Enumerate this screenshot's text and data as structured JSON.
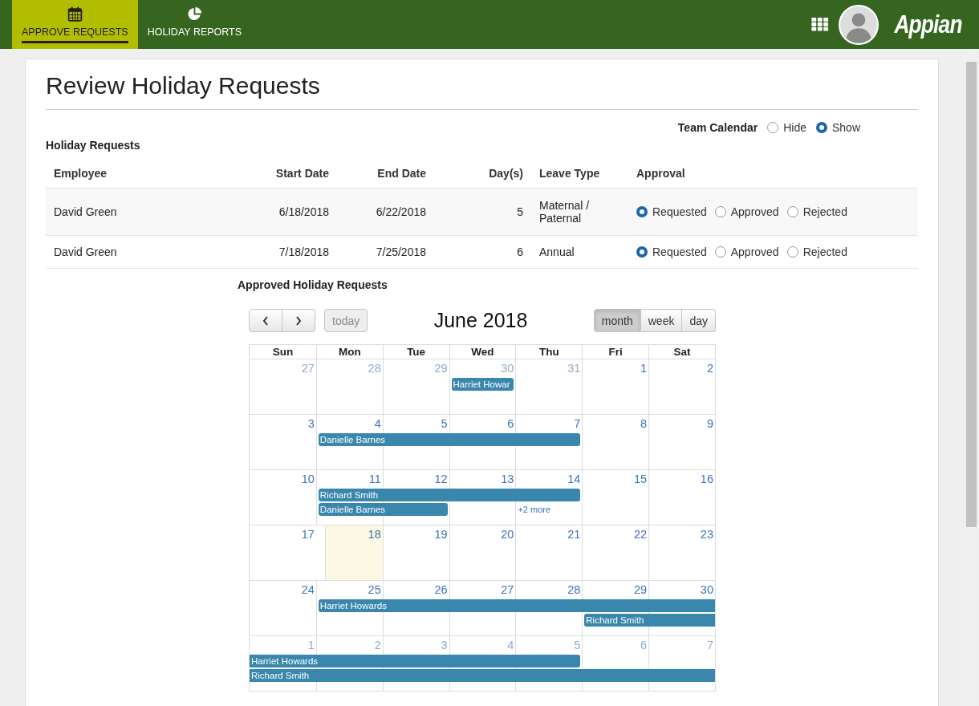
{
  "nav": {
    "tabs": [
      {
        "label": "APPROVE REQUESTS",
        "selected": true
      },
      {
        "label": "HOLIDAY REPORTS",
        "selected": false
      }
    ],
    "logo": "Appian"
  },
  "page": {
    "title": "Review Holiday Requests",
    "team_calendar": {
      "label": "Team Calendar",
      "options": [
        {
          "label": "Hide",
          "selected": false
        },
        {
          "label": "Show",
          "selected": true
        }
      ]
    },
    "requests": {
      "title": "Holiday Requests",
      "columns": [
        "Employee",
        "Start Date",
        "End Date",
        "Day(s)",
        "Leave Type",
        "Approval"
      ],
      "rows": [
        {
          "employee": "David Green",
          "start": "6/18/2018",
          "end": "6/22/2018",
          "days": "5",
          "leave_type": "Maternal / Paternal",
          "approval": [
            {
              "label": "Requested",
              "selected": true
            },
            {
              "label": "Approved",
              "selected": false
            },
            {
              "label": "Rejected",
              "selected": false
            }
          ]
        },
        {
          "employee": "David Green",
          "start": "7/18/2018",
          "end": "7/25/2018",
          "days": "6",
          "leave_type": "Annual",
          "approval": [
            {
              "label": "Requested",
              "selected": true
            },
            {
              "label": "Approved",
              "selected": false
            },
            {
              "label": "Rejected",
              "selected": false
            }
          ]
        }
      ]
    },
    "calendar": {
      "title": "Approved Holiday Requests",
      "today_button": "today",
      "month": "June 2018",
      "views": [
        {
          "label": "month",
          "selected": true
        },
        {
          "label": "week",
          "selected": false
        },
        {
          "label": "day",
          "selected": false
        }
      ],
      "weekdays": [
        "Sun",
        "Mon",
        "Tue",
        "Wed",
        "Thu",
        "Fri",
        "Sat"
      ],
      "weeks": [
        {
          "days": [
            {
              "n": "27",
              "other_month": true,
              "today": false
            },
            {
              "n": "28",
              "other_month": true,
              "today": false
            },
            {
              "n": "29",
              "other_month": true,
              "today": false
            },
            {
              "n": "30",
              "other_month": true,
              "today": false
            },
            {
              "n": "31",
              "other_month": true,
              "today": false
            },
            {
              "n": "1",
              "other_month": false,
              "today": false
            },
            {
              "n": "2",
              "other_month": false,
              "today": false
            }
          ],
          "events": [
            {
              "title": "Harriet Howar",
              "continues_before": false,
              "continues_after": false
            }
          ]
        },
        {
          "days": [
            {
              "n": "3",
              "other_month": false,
              "today": false
            },
            {
              "n": "4",
              "other_month": false,
              "today": false
            },
            {
              "n": "5",
              "other_month": false,
              "today": false
            },
            {
              "n": "6",
              "other_month": false,
              "today": false
            },
            {
              "n": "7",
              "other_month": false,
              "today": false
            },
            {
              "n": "8",
              "other_month": false,
              "today": false
            },
            {
              "n": "9",
              "other_month": false,
              "today": false
            }
          ],
          "events": [
            {
              "title": "Danielle Barnes",
              "continues_before": false,
              "continues_after": false
            }
          ]
        },
        {
          "days": [
            {
              "n": "10",
              "other_month": false,
              "today": false
            },
            {
              "n": "11",
              "other_month": false,
              "today": false
            },
            {
              "n": "12",
              "other_month": false,
              "today": false
            },
            {
              "n": "13",
              "other_month": false,
              "today": false
            },
            {
              "n": "14",
              "other_month": false,
              "today": false
            },
            {
              "n": "15",
              "other_month": false,
              "today": false
            },
            {
              "n": "16",
              "other_month": false,
              "today": false
            }
          ],
          "events": [
            {
              "title": "Richard Smith",
              "continues_before": false,
              "continues_after": false
            },
            {
              "title": "Danielle Barnes",
              "continues_before": false,
              "continues_after": false
            }
          ],
          "more": "+2 more"
        },
        {
          "days": [
            {
              "n": "17",
              "other_month": false,
              "today": false
            },
            {
              "n": "18",
              "other_month": false,
              "today": true
            },
            {
              "n": "19",
              "other_month": false,
              "today": false
            },
            {
              "n": "20",
              "other_month": false,
              "today": false
            },
            {
              "n": "21",
              "other_month": false,
              "today": false
            },
            {
              "n": "22",
              "other_month": false,
              "today": false
            },
            {
              "n": "23",
              "other_month": false,
              "today": false
            }
          ]
        },
        {
          "days": [
            {
              "n": "24",
              "other_month": false,
              "today": false
            },
            {
              "n": "25",
              "other_month": false,
              "today": false
            },
            {
              "n": "26",
              "other_month": false,
              "today": false
            },
            {
              "n": "27",
              "other_month": false,
              "today": false
            },
            {
              "n": "28",
              "other_month": false,
              "today": false
            },
            {
              "n": "29",
              "other_month": false,
              "today": false
            },
            {
              "n": "30",
              "other_month": false,
              "today": false
            }
          ],
          "events": [
            {
              "title": "Harriet Howards",
              "continues_before": false,
              "continues_after": true
            },
            {
              "title": "Richard Smith",
              "continues_before": false,
              "continues_after": true
            }
          ]
        },
        {
          "days": [
            {
              "n": "1",
              "other_month": true,
              "today": false
            },
            {
              "n": "2",
              "other_month": true,
              "today": false
            },
            {
              "n": "3",
              "other_month": true,
              "today": false
            },
            {
              "n": "4",
              "other_month": true,
              "today": false
            },
            {
              "n": "5",
              "other_month": true,
              "today": false
            },
            {
              "n": "6",
              "other_month": true,
              "today": false
            },
            {
              "n": "7",
              "other_month": true,
              "today": false
            }
          ],
          "events": [
            {
              "title": "Harriet Howards",
              "continues_before": true,
              "continues_after": false
            },
            {
              "title": "Richard Smith",
              "continues_before": true,
              "continues_after": true
            }
          ]
        }
      ]
    }
  }
}
